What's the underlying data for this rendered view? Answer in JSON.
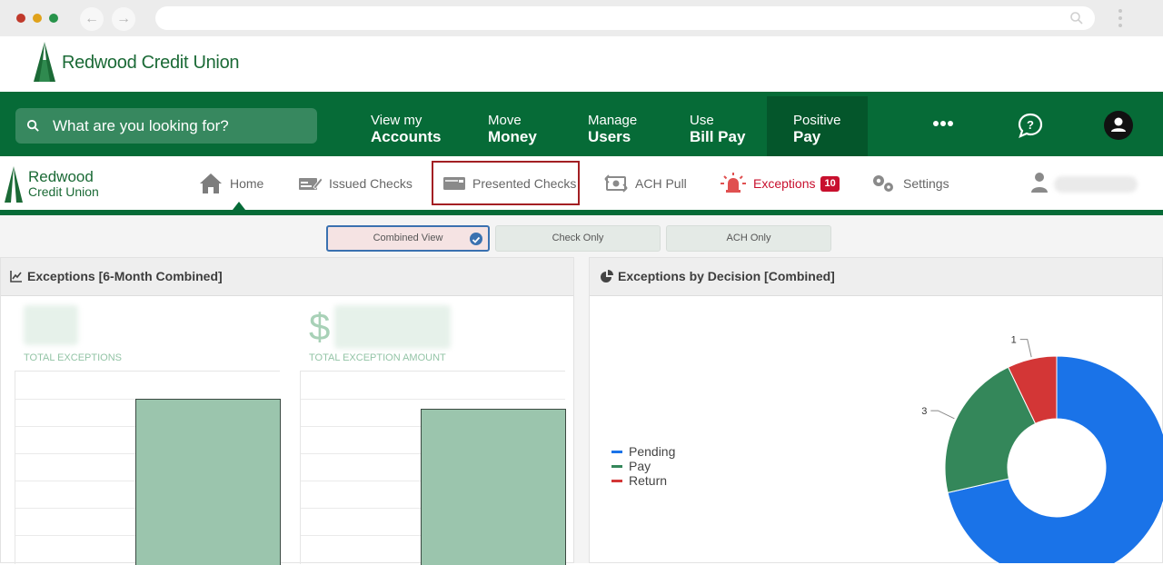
{
  "browser": {
    "dot_colors": [
      "#c0392b",
      "#e0a21b",
      "#27934a"
    ]
  },
  "brand": {
    "name": "Redwood Credit Union",
    "color": "#1b6a36"
  },
  "main_nav": {
    "search_placeholder": "What are you looking for?",
    "items": [
      {
        "line1": "View my",
        "line2": "Accounts"
      },
      {
        "line1": "Move",
        "line2": "Money"
      },
      {
        "line1": "Manage",
        "line2": "Users"
      },
      {
        "line1": "Use",
        "line2": "Bill Pay"
      },
      {
        "line1": "Positive",
        "line2": "Pay",
        "active": true
      }
    ],
    "more_icon": "more-horizontal-icon",
    "help_icon": "help-chat-icon",
    "user_icon": "user-account-icon",
    "color": "#066b37"
  },
  "sub_nav": {
    "logo_line1": "Redwood",
    "logo_line2": "Credit Union",
    "items": [
      {
        "label": "Home",
        "icon": "home-icon",
        "active": true
      },
      {
        "label": "Issued Checks",
        "icon": "issued-checks-icon"
      },
      {
        "label": "Presented Checks",
        "icon": "presented-checks-icon",
        "highlighted": true
      },
      {
        "label": "ACH Pull",
        "icon": "ach-pull-icon"
      },
      {
        "label": "Exceptions",
        "icon": "alarm-bell-icon",
        "badge": "10",
        "color": "#c8102e"
      },
      {
        "label": "Settings",
        "icon": "settings-gears-icon"
      }
    ]
  },
  "view_toggle": {
    "options": [
      "Combined View",
      "Check Only",
      "ACH Only"
    ],
    "selected": "Combined View"
  },
  "exceptions_panel": {
    "title": "Exceptions [6-Month Combined]",
    "kpi_total_label": "TOTAL EXCEPTIONS",
    "kpi_amount_symbol": "$",
    "kpi_amount_label": "TOTAL EXCEPTION AMOUNT"
  },
  "decision_panel": {
    "title": "Exceptions by Decision [Combined]"
  },
  "chart_data": [
    {
      "type": "pie",
      "title": "Exceptions by Decision [Combined]",
      "donut": true,
      "labels": [
        "Pending",
        "Pay",
        "Return"
      ],
      "values": [
        10,
        3,
        1
      ],
      "colors": [
        "#1a73e8",
        "#34875a",
        "#d33636"
      ],
      "slice_labels": [
        "",
        "3",
        "1"
      ],
      "legend_position": "left"
    }
  ]
}
